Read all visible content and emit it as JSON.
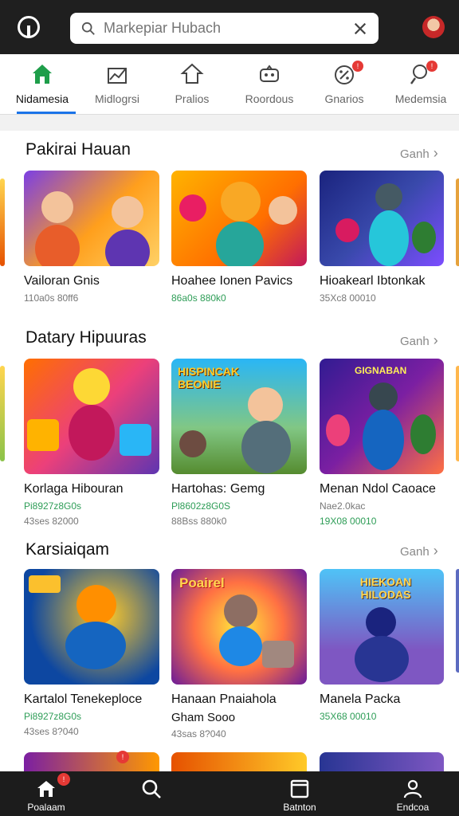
{
  "search": {
    "placeholder": "Markepiar Hubach"
  },
  "categories": [
    {
      "label": "Nidamesia",
      "icon": "home-icon",
      "active": true
    },
    {
      "label": "Midlogrsi",
      "icon": "chart-icon"
    },
    {
      "label": "Pralios",
      "icon": "tag-icon"
    },
    {
      "label": "Roordous",
      "icon": "gamepad-icon"
    },
    {
      "label": "Gnarios",
      "icon": "percent-icon",
      "badge": "!"
    },
    {
      "label": "Medemsia",
      "icon": "person-search-icon",
      "badge": "!"
    }
  ],
  "sections": [
    {
      "title": "Pakirai Hauan",
      "see_all": "Ganh",
      "cards": [
        {
          "title": "Vailoran Gnis",
          "meta": "110a0s 80ff6"
        },
        {
          "title": "Hoahee Ionen Pavics",
          "meta": "86a0s 880k0"
        },
        {
          "title": "Hioakearl Ibtonkak",
          "meta": "35Xc8 00010"
        }
      ]
    },
    {
      "title": "Datary Hipuuras",
      "see_all": "Ganh",
      "cards": [
        {
          "title": "Korlaga Hibouran",
          "meta": "Pi8927z8G0s",
          "meta2": "43ses 82000",
          "banner": ""
        },
        {
          "title": "Hartohas: Gemg",
          "meta": "Pl8602z8G0S",
          "meta2": "88Bss 880k0",
          "banner": "HISPINCAK BEONIE"
        },
        {
          "title": "Menan Ndol Caoace",
          "meta": "Nae2.0kac",
          "meta2": "19X08 00010",
          "banner": "GIGNABAN"
        }
      ]
    },
    {
      "title": "Karsiaiqam",
      "see_all": "Ganh",
      "cards": [
        {
          "title": "Kartalol Tenekeploce",
          "meta": "Pi8927z8G0s",
          "meta2": "43ses 8?040"
        },
        {
          "title": "Hanaan Pnaiahola",
          "meta": "Gham Sooo",
          "meta2": "43sas 8?040",
          "banner": "Poairel"
        },
        {
          "title": "Manela Packa",
          "meta": "35X68 00010",
          "banner": "HIEKOAN HILODAS"
        }
      ]
    }
  ],
  "nav": [
    {
      "label": "Poalaam",
      "icon": "home-icon",
      "badge": "!"
    },
    {
      "label": "",
      "icon": "search-icon"
    },
    {
      "label": "Batnton",
      "icon": "tablet-icon"
    },
    {
      "label": "Endcoa",
      "icon": "person-icon"
    }
  ],
  "colors": {
    "topbar": "#1f1f1f",
    "accent": "#1a73e8",
    "badge": "#e53935",
    "meta_green": "#2e9d57"
  }
}
